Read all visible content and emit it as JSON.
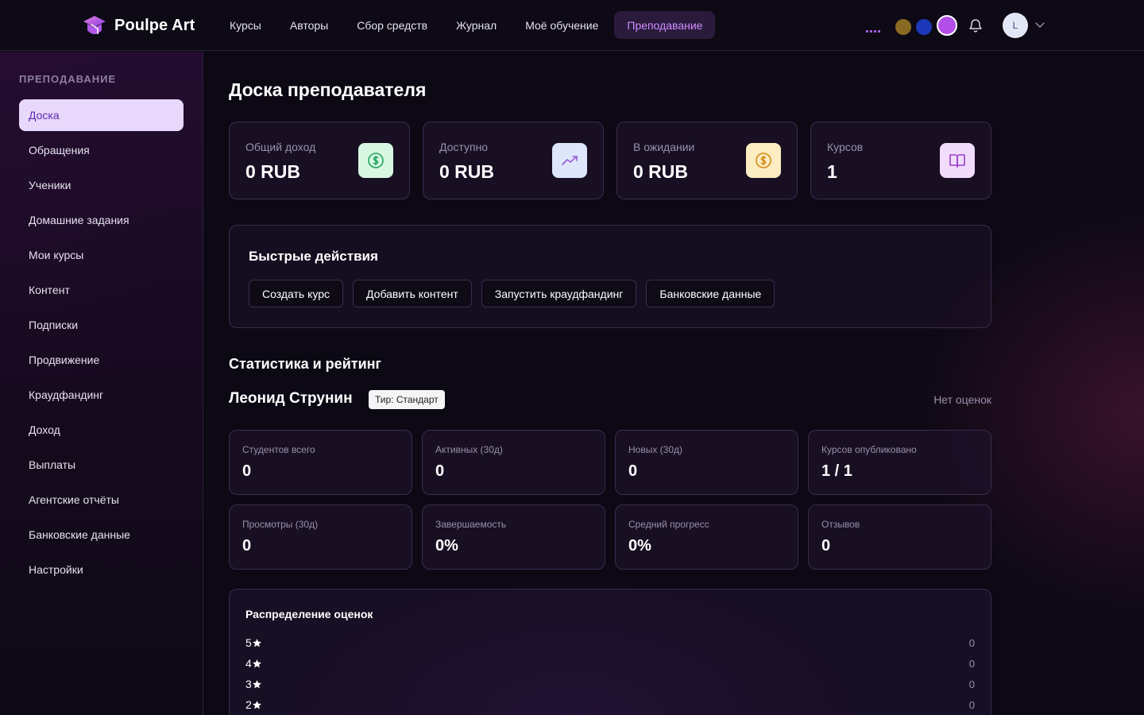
{
  "app": {
    "name": "Poulpe Art"
  },
  "nav": {
    "items": [
      {
        "label": "Курсы"
      },
      {
        "label": "Авторы"
      },
      {
        "label": "Сбор средств"
      },
      {
        "label": "Журнал"
      },
      {
        "label": "Моё обучение"
      },
      {
        "label": "Преподавание",
        "active": true
      }
    ]
  },
  "header": {
    "swatches": [
      "#8a6a22",
      "#1c37b8",
      "#b24fe8"
    ],
    "avatar_initial": "L",
    "accent": "#b066ff"
  },
  "sidebar": {
    "title": "ПРЕПОДАВАНИЕ",
    "items": [
      {
        "label": "Доска",
        "active": true
      },
      {
        "label": "Обращения"
      },
      {
        "label": "Ученики"
      },
      {
        "label": "Домашние задания"
      },
      {
        "label": "Мои курсы"
      },
      {
        "label": "Контент"
      },
      {
        "label": "Подписки"
      },
      {
        "label": "Продвижение"
      },
      {
        "label": "Краудфандинг"
      },
      {
        "label": "Доход"
      },
      {
        "label": "Выплаты"
      },
      {
        "label": "Агентские отчёты"
      },
      {
        "label": "Банковские данные"
      },
      {
        "label": "Настройки"
      }
    ]
  },
  "main": {
    "title": "Доска преподавателя",
    "stats": [
      {
        "label": "Общий доход",
        "value": "0 RUB",
        "icon": "dollar-icon",
        "icon_bg": "#d8f7e2",
        "icon_color": "#22a35a"
      },
      {
        "label": "Доступно",
        "value": "0 RUB",
        "icon": "trending-up-icon",
        "icon_bg": "#dde6fb",
        "icon_color": "#9a5bd8"
      },
      {
        "label": "В ожидании",
        "value": "0 RUB",
        "icon": "coin-icon",
        "icon_bg": "#fbecc2",
        "icon_color": "#d48a12"
      },
      {
        "label": "Курсов",
        "value": "1",
        "icon": "book-icon",
        "icon_bg": "#f1dcfb",
        "icon_color": "#9a3fd0"
      }
    ],
    "quick_actions": {
      "title": "Быстрые действия",
      "buttons": [
        {
          "label": "Создать курс"
        },
        {
          "label": "Добавить контент"
        },
        {
          "label": "Запустить краудфандинг"
        },
        {
          "label": "Банковские данные"
        }
      ]
    },
    "stats_section": {
      "title": "Статистика и рейтинг",
      "teacher_name": "Леонид Струнин",
      "tier": "Тир: Стандарт",
      "no_ratings": "Нет оценок",
      "metrics": [
        {
          "label": "Студентов всего",
          "value": "0"
        },
        {
          "label": "Активных (30д)",
          "value": "0"
        },
        {
          "label": "Новых (30д)",
          "value": "0"
        },
        {
          "label": "Курсов опубликовано",
          "value": "1 / 1"
        },
        {
          "label": "Просмотры (30д)",
          "value": "0"
        },
        {
          "label": "Завершаемость",
          "value": "0%"
        },
        {
          "label": "Средний прогресс",
          "value": "0%"
        },
        {
          "label": "Отзывов",
          "value": "0"
        }
      ]
    },
    "distribution": {
      "title": "Распределение оценок",
      "rows": [
        {
          "stars": "5",
          "count": "0"
        },
        {
          "stars": "4",
          "count": "0"
        },
        {
          "stars": "3",
          "count": "0"
        },
        {
          "stars": "2",
          "count": "0"
        }
      ]
    }
  }
}
